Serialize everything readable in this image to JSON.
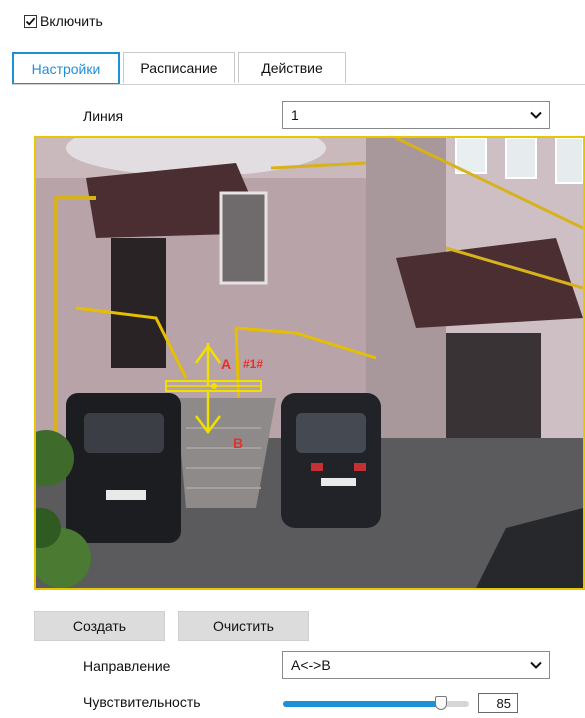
{
  "enable": {
    "label": "Включить",
    "checked": true
  },
  "tabs": [
    {
      "label": "Настройки",
      "active": true
    },
    {
      "label": "Расписание",
      "active": false
    },
    {
      "label": "Действие",
      "active": false
    }
  ],
  "line": {
    "label": "Линия",
    "value": "1"
  },
  "overlay": {
    "point_a": "A",
    "point_b": "B",
    "line_id": "#1#"
  },
  "buttons": {
    "create": "Создать",
    "clear": "Очистить"
  },
  "direction": {
    "label": "Направление",
    "value": "A<->B"
  },
  "sensitivity": {
    "label": "Чувствительность",
    "value": "85",
    "level": 0.85
  },
  "colors": {
    "accent": "#1f8fd6",
    "frame": "#e6c800",
    "overlay_text": "#e8302a",
    "overlay_line": "#f0e000"
  }
}
